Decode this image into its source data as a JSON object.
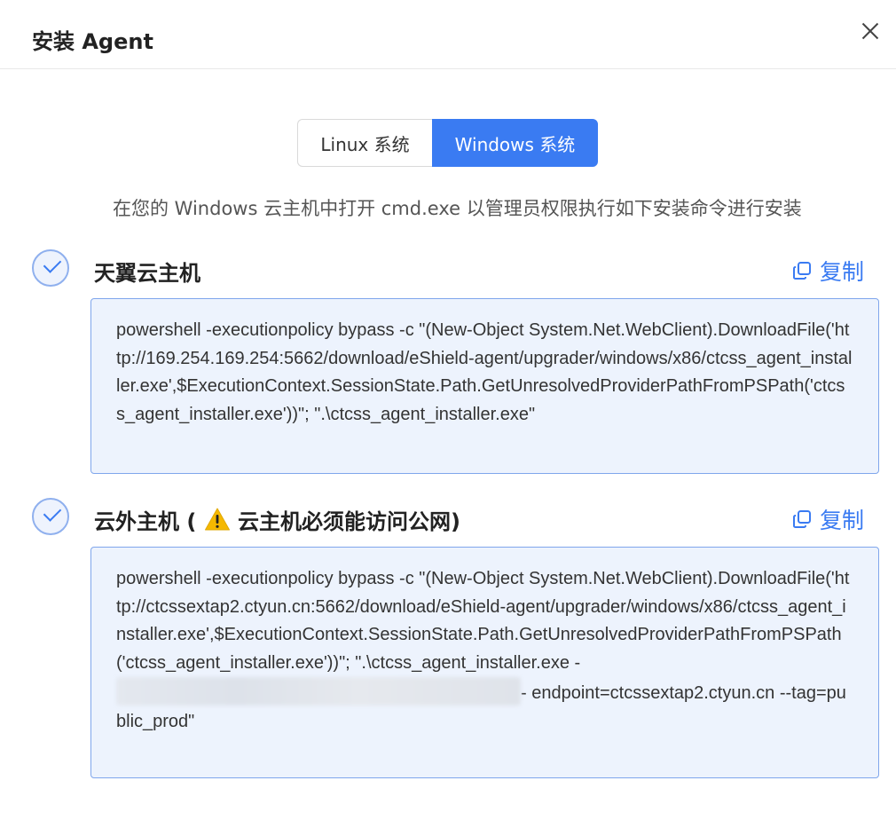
{
  "dialog": {
    "title": "安装 Agent"
  },
  "tabs": [
    {
      "label": "Linux 系统",
      "active": false
    },
    {
      "label": "Windows 系统",
      "active": true
    }
  ],
  "instruction": "在您的 Windows 云主机中打开 cmd.exe 以管理员权限执行如下安装命令进行安装",
  "sections": [
    {
      "title": "天翼云主机",
      "copy_label": "复制",
      "command": "powershell -executionpolicy bypass -c \"(New-Object System.Net.WebClient).DownloadFile('http://169.254.169.254:5662/download/eShield-agent/upgrader/windows/x86/ctcss_agent_installer.exe',$ExecutionContext.SessionState.Path.GetUnresolvedProviderPathFromPSPath('ctcss_agent_installer.exe'))\"; \".\\ctcss_agent_installer.exe\""
    },
    {
      "title_prefix": "云外主机 (",
      "title_suffix": "云主机必须能访问公网)",
      "copy_label": "复制",
      "command_part1": "powershell -executionpolicy bypass -c \"(New-Object System.Net.WebClient).DownloadFile('http://ctcssextap2.ctyun.cn:5662/download/eShield-agent/upgrader/windows/x86/ctcss_agent_installer.exe',$ExecutionContext.SessionState.Path.GetUnresolvedProviderPathFromPSPath('ctcss_agent_installer.exe'))\"; \".\\ctcss_agent_installer.exe -",
      "command_part2": "- endpoint=ctcssextap2.ctyun.cn --tag=public_prod\""
    }
  ],
  "colors": {
    "accent": "#3a7bf2",
    "code_bg": "#edf3fd",
    "code_border": "#7fa6ec",
    "warning": "#f5b800"
  }
}
